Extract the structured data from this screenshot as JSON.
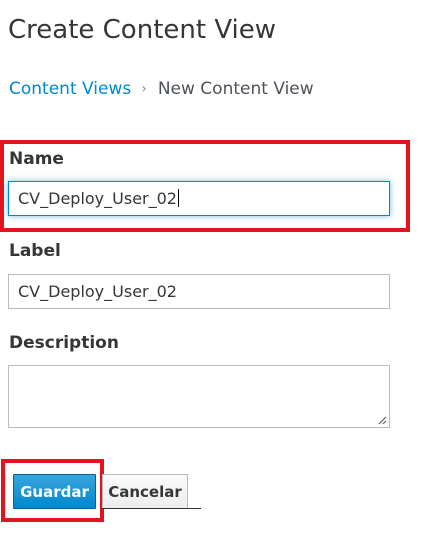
{
  "page": {
    "title": "Create Content View"
  },
  "breadcrumb": {
    "parent": "Content Views",
    "separator": "›",
    "current": "New Content View"
  },
  "form": {
    "name": {
      "label": "Name",
      "value": "CV_Deploy_User_02",
      "focused": true
    },
    "label_field": {
      "label": "Label",
      "value": "CV_Deploy_User_02"
    },
    "description": {
      "label": "Description",
      "value": ""
    }
  },
  "actions": {
    "save_label": "Guardar",
    "cancel_label": "Cancelar"
  },
  "colors": {
    "link": "#0088ce",
    "primary": "#0088ce",
    "highlight": "#e3141f"
  }
}
